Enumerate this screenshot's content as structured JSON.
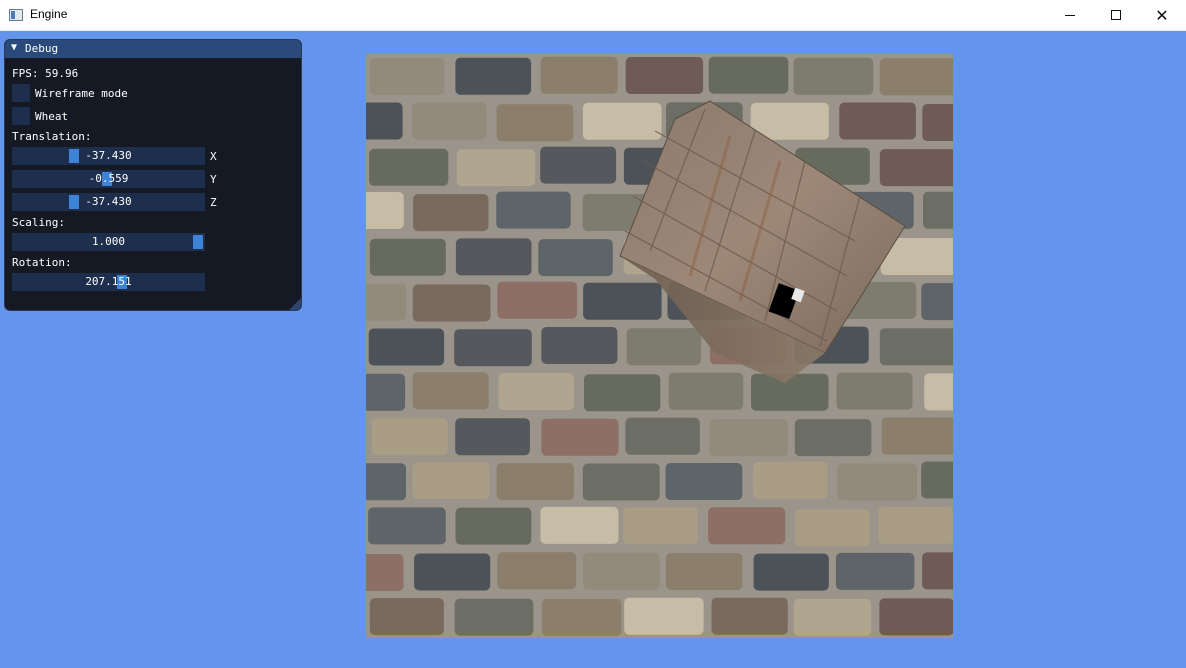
{
  "window": {
    "title": "Engine",
    "icon": "app-window-icon",
    "controls": {
      "minimize": "minimize-icon",
      "maximize": "maximize-icon",
      "close": "close-icon",
      "close_glyph": "✕"
    }
  },
  "viewport": {
    "clear_color": "#6495ed"
  },
  "debug": {
    "title": "Debug",
    "collapse_glyph": "▼",
    "fps_label": "FPS: 59.96",
    "wireframe_label": "Wireframe mode",
    "wireframe_checked": false,
    "wheat_label": "Wheat",
    "wheat_checked": false,
    "translation_label": "Translation:",
    "translation": [
      {
        "value": "-37.430",
        "axis": "X",
        "fraction": 0.31
      },
      {
        "value": "-0.559",
        "axis": "Y",
        "fraction": 0.49
      },
      {
        "value": "-37.430",
        "axis": "Z",
        "fraction": 0.31
      }
    ],
    "scaling_label": "Scaling:",
    "scaling": {
      "value": "1.000",
      "fraction": 1.0
    },
    "rotation_label": "Rotation:",
    "rotation": {
      "value": "207.151",
      "fraction": 0.575
    },
    "colors": {
      "header": "#294a7a",
      "frame": "#1d2f4c",
      "grab": "#3d84d6"
    }
  }
}
